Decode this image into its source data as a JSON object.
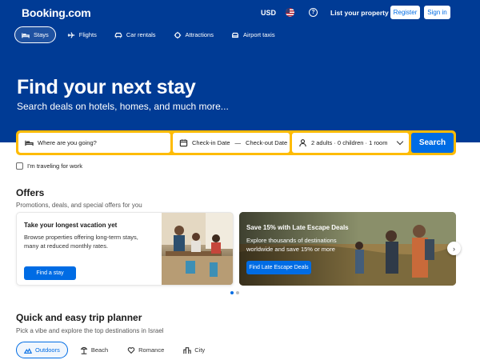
{
  "header": {
    "logo": "Booking.com",
    "currency": "USD",
    "help_glyph": "?",
    "list_property": "List your property",
    "register": "Register",
    "sign_in": "Sign in"
  },
  "nav": [
    {
      "label": "Stays",
      "icon": "bed-icon",
      "active": true
    },
    {
      "label": "Flights",
      "icon": "plane-icon"
    },
    {
      "label": "Car rentals",
      "icon": "car-icon"
    },
    {
      "label": "Attractions",
      "icon": "attractions-icon"
    },
    {
      "label": "Airport taxis",
      "icon": "taxi-icon"
    }
  ],
  "hero": {
    "title": "Find your next stay",
    "subtitle": "Search deals on hotels, homes, and much more..."
  },
  "search": {
    "destination_placeholder": "Where are you going?",
    "checkin": "Check-in Date",
    "dash": "—",
    "checkout": "Check-out Date",
    "guests": "2 adults · 0 children · 1 room",
    "button": "Search",
    "work_travel": "I'm traveling for work"
  },
  "offers": {
    "title": "Offers",
    "subtitle": "Promotions, deals, and special offers for you",
    "card1": {
      "title": "Take your longest vacation yet",
      "text": "Browse properties offering long-term stays, many at reduced monthly rates.",
      "button": "Find a stay"
    },
    "card2": {
      "title": "Save 15% with Late Escape Deals",
      "text": "Explore thousands of destinations worldwide and save 15% or more",
      "button": "Find Late Escape Deals"
    },
    "next_arrow": "›",
    "carousel_position": 1,
    "carousel_count": 2
  },
  "trip": {
    "title": "Quick and easy trip planner",
    "subtitle": "Pick a vibe and explore the top destinations in Israel",
    "chips": [
      {
        "label": "Outdoors",
        "icon": "hiker-icon",
        "active": true
      },
      {
        "label": "Beach",
        "icon": "beach-icon"
      },
      {
        "label": "Romance",
        "icon": "heart-icon"
      },
      {
        "label": "City",
        "icon": "city-icon"
      }
    ]
  },
  "colors": {
    "brand_blue": "#003b95",
    "action_blue": "#006ce4",
    "search_border": "#febb02"
  }
}
